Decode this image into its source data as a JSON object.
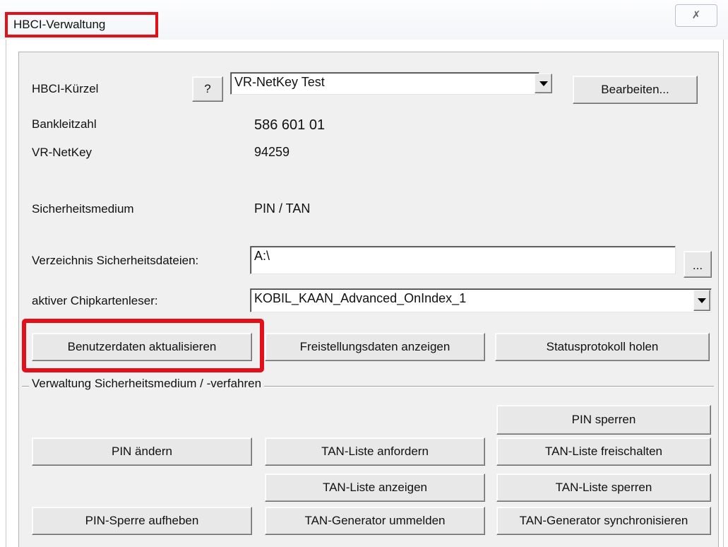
{
  "window": {
    "title": "HBCI-Verwaltung",
    "close_glyph": "✗"
  },
  "fields": {
    "hbci_kuerzel_label": "HBCI-Kürzel",
    "help_button": "?",
    "hbci_kuerzel_value": "VR-NetKey Test",
    "edit_button": "Bearbeiten...",
    "bankleitzahl_label": "Bankleitzahl",
    "bankleitzahl_value": "586 601 01",
    "vr_netkey_label": "VR-NetKey",
    "vr_netkey_value": "94259",
    "sicherheitsmedium_label": "Sicherheitsmedium",
    "sicherheitsmedium_value": "PIN / TAN",
    "verzeichnis_label": "Verzeichnis Sicherheitsdateien:",
    "verzeichnis_value": "A:\\",
    "browse_button": "...",
    "chipkartenleser_label": "aktiver Chipkartenleser:",
    "chipkartenleser_value": "KOBIL_KAAN_Advanced_OnIndex_1"
  },
  "actions": {
    "benutzerdaten": "Benutzerdaten aktualisieren",
    "freistellungsdaten": "Freistellungsdaten anzeigen",
    "statusprotokoll": "Statusprotokoll holen"
  },
  "group": {
    "label": "Verwaltung Sicherheitsmedium / -verfahren",
    "pin_sperren": "PIN sperren",
    "pin_aendern": "PIN ändern",
    "tan_liste_anfordern": "TAN-Liste anfordern",
    "tan_liste_freischalten": "TAN-Liste freischalten",
    "tan_liste_anzeigen": "TAN-Liste anzeigen",
    "tan_liste_sperren": "TAN-Liste sperren",
    "pin_sperre_aufheben": "PIN-Sperre aufheben",
    "tan_generator_ummelden": "TAN-Generator ummelden",
    "tan_generator_synchronisieren": "TAN-Generator synchronisieren"
  },
  "colors": {
    "highlight": "#e3101a",
    "dialog_bg": "#f0f0f0"
  }
}
